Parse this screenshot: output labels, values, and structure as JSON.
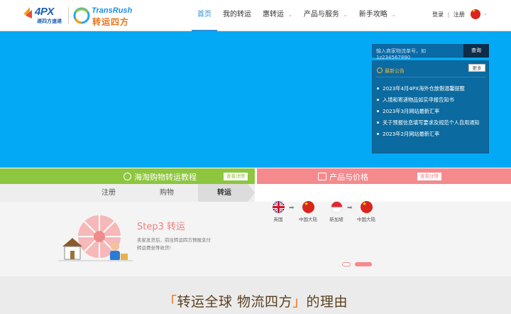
{
  "brand": {
    "logo_4px_text": "4PX",
    "logo_4px_sub": "递四方速递",
    "logo_tr_en": "TransRush",
    "logo_tr_zh": "转运四方"
  },
  "nav": {
    "items": [
      {
        "label": "首页"
      },
      {
        "label": "我的转运"
      },
      {
        "label": "惠转运"
      },
      {
        "label": "产品与服务"
      },
      {
        "label": "新手攻略"
      }
    ]
  },
  "auth": {
    "login": "登录",
    "sep": "|",
    "register": "注册"
  },
  "search": {
    "placeholder": "输入商家物流单号，如1z234567890",
    "button": "查询"
  },
  "notice": {
    "title": "最新公告",
    "more": "更多",
    "items": [
      "2023年4月4PX海外仓放假温馨提醒",
      "入境和寄递物品如实申报告知书",
      "2023年3月网站最新汇率",
      "关于预报信息填写要求及规范个人自用通知",
      "2023年2月网站最新汇率"
    ]
  },
  "panel_left": {
    "title": "海淘购物转运教程",
    "button": "查看详情",
    "tabs": [
      {
        "label": "注册"
      },
      {
        "label": "购物"
      },
      {
        "label": "转运"
      }
    ]
  },
  "panel_right": {
    "title": "产品与价格",
    "button": "查看详情"
  },
  "step": {
    "title": "Step3 转运",
    "desc": "卖家发货后，前往转运四方预报支付转运费坐等收货!"
  },
  "routes": [
    {
      "from": "英国",
      "to": "中国大陆"
    },
    {
      "from": "新加坡",
      "to": "中国大陆"
    }
  ],
  "reason": {
    "open": "「",
    "text_a": "转运全球 物流四方",
    "close": "」",
    "text_b": "的理由"
  },
  "colors": {
    "hero": "#03a9f4",
    "green": "#8dc63f",
    "pink": "#f48a8e",
    "accent": "#2a8fd8"
  }
}
